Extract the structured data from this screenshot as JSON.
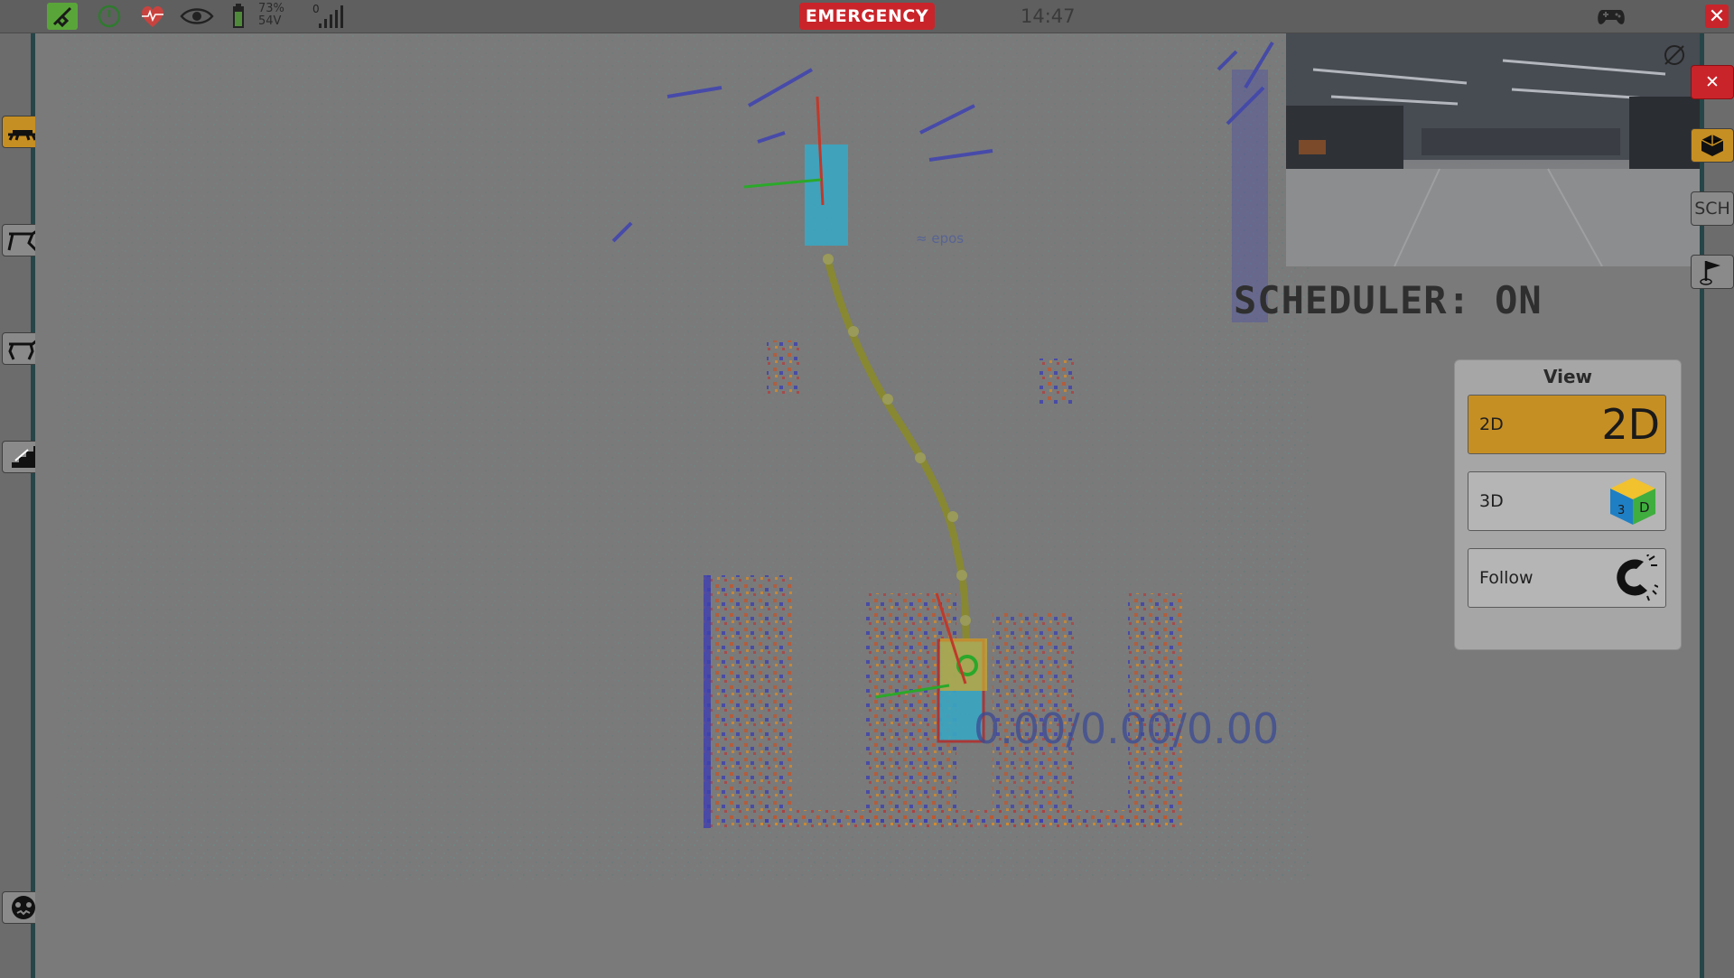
{
  "topbar": {
    "battery_percent": "73%",
    "battery_voltage": "54V",
    "signal_level": "0",
    "emergency_label": "EMERGENCY",
    "clock": "14:47",
    "close_symbol": "✕"
  },
  "left_sidebar": {
    "items": [
      {
        "icon": "robot-lying-icon",
        "active": true
      },
      {
        "icon": "robot-sit-icon",
        "active": false
      },
      {
        "icon": "robot-stand-icon",
        "active": false
      },
      {
        "icon": "stairs-icon",
        "active": false
      },
      {
        "icon": "robot-face-icon",
        "active": false
      }
    ]
  },
  "right_sidebar": {
    "close_symbol": "✕",
    "cube_icon": "cube-icon",
    "sch_label": "SCH",
    "flag_icon": "flag-icon"
  },
  "map": {
    "scheduler_status": "SCHEDULER: ON",
    "speed_readout": "0.00/0.00/0.00",
    "epos_label": "≈ epos"
  },
  "view_panel": {
    "title": "View",
    "buttons": [
      {
        "label": "2D",
        "icon_text": "2D",
        "active": true
      },
      {
        "label": "3D",
        "icon_text": "3D",
        "active": false
      },
      {
        "label": "Follow",
        "icon": "magnet-icon",
        "active": false
      }
    ]
  },
  "colors": {
    "accent": "#c68f23",
    "emergency": "#c9242a",
    "robot_body": "#3aa6c2",
    "path": "#8a8a2a"
  }
}
